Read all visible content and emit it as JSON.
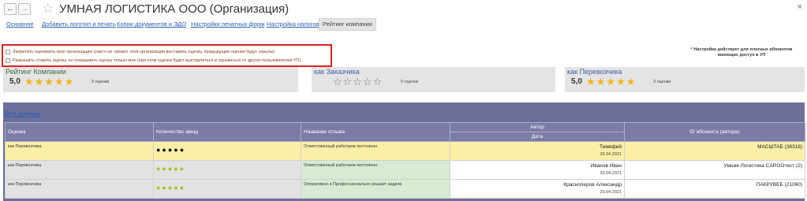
{
  "window": {
    "title": "УМНАЯ ЛОГИСТИКА ООО (Организация)",
    "back_glyph": "←",
    "forward_glyph": "→",
    "favorite_glyph": "☆",
    "close_glyph": "×"
  },
  "tabs": [
    {
      "label": "Основное"
    },
    {
      "label": "Добавить логотип и печать"
    },
    {
      "label": "Копии документов и ЭДО"
    },
    {
      "label": "Настройки печатных форм"
    },
    {
      "label": "Настройка налогов"
    },
    {
      "label": "Рейтинг компании",
      "active": true
    }
  ],
  "options": {
    "forbid_rating": {
      "label": "Запретить оценивать мою организацию (никто не сможет этой организации выставить оценку, предыдущие оценки будут скрыты)",
      "checked": false
    },
    "allow_hidden": {
      "label": "Разрешить ставить оценку, но показывать оценку только мне (при этом оценка будет выставляться и скрываться от других пользователей УП)",
      "checked": false
    },
    "note_line1": "* Настройка действует для платных абонентов",
    "note_line2": "имеющих доступ в УП"
  },
  "ratings": {
    "company": {
      "title": "Рейтинг Компании",
      "value": "5,0",
      "stars": "★★★★★",
      "count": "3 оценки"
    },
    "customer": {
      "title": "как Заказчика",
      "stars": "☆☆☆☆☆",
      "count": "0 оценок"
    },
    "carrier": {
      "title": "как Перевозчика",
      "value": "5,0",
      "stars": "★★★★★",
      "count": "3 оценки"
    }
  },
  "grid": {
    "all_link": "Все оценки",
    "headers": {
      "rating": "Оценка",
      "stars": "Количество звезд",
      "review": "Название отзыва",
      "author": "Автор",
      "date": "Дата",
      "subscriber": "ID абонента (автора)"
    },
    "rows": [
      {
        "rating": "как Перевозчика",
        "stars": "●●●●●",
        "review": "Ответственный работаем постоянно",
        "author": "Тимофей",
        "date": "29.04.2021",
        "subscriber": "МАСШТАБ (38318)"
      },
      {
        "rating": "как Перевозчика",
        "stars": "●●●●●",
        "review": "Ответственный работаем постоянно",
        "author": "Иванов Иван",
        "date": "29.04.2021",
        "subscriber": "Умная Логистика CARGOтест (2)"
      },
      {
        "rating": "как Перевозчика",
        "stars": "●●●●●",
        "review": "Оперативно и Профессионально решает задачи",
        "author": "Красноперов Александр",
        "date": "29.04.2021",
        "subscriber": "ПАКРУВЕБ (21060)"
      }
    ]
  },
  "colors": {
    "link": "#2a5db0",
    "highlight_border": "#e02020",
    "star_gold": "#f3b21a",
    "dot_green": "#a1c51c",
    "selected_row": "#fbeea6",
    "grid_header": "#7b7ba6"
  }
}
